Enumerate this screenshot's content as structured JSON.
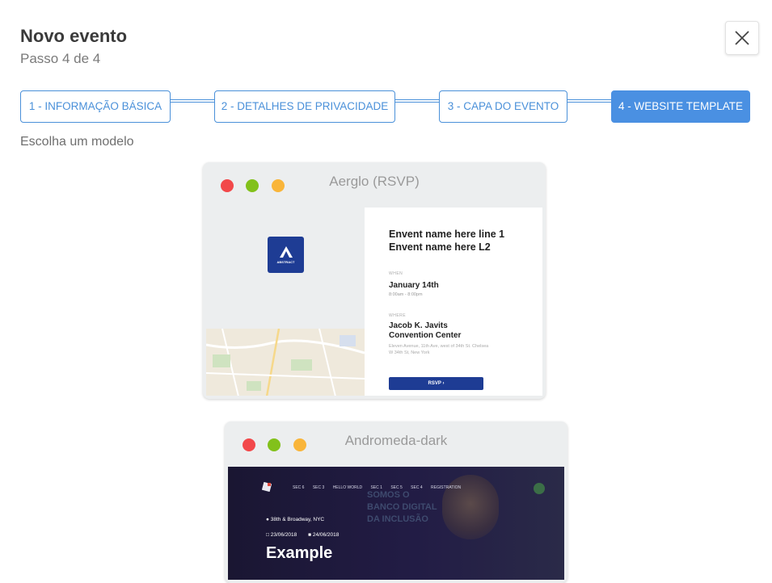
{
  "header": {
    "title": "Novo evento",
    "subtitle": "Passo 4 de 4"
  },
  "stepper": {
    "steps": [
      {
        "label": "1 - Informação básica",
        "active": false
      },
      {
        "label": "2 - Detalhes de privacidade",
        "active": false
      },
      {
        "label": "3 - Capa do evento",
        "active": false
      },
      {
        "label": "4 - Website template",
        "active": true
      }
    ]
  },
  "hint": "Escolha um modelo",
  "colors": {
    "accent": "#4a90e2",
    "dot_red": "#f2484a",
    "dot_green": "#82c11b",
    "dot_yellow": "#f9b53a",
    "aerglo_brand": "#1e3c94"
  },
  "templates": [
    {
      "name": "Aerglo (RSVP)",
      "preview": {
        "logo_text": "ABSTRACT",
        "event_name_line1": "Envent name here line 1",
        "event_name_line2": "Envent name here L2",
        "when_label": "WHEN",
        "date": "January 14th",
        "time": "8:00am - 8:00pm",
        "where_label": "WHERE",
        "venue_line1": "Jacob K. Javits",
        "venue_line2": "Convention Center",
        "address_line1": "Eleven Avenue, 11th Ave, west of 34th St. Chelsea",
        "address_line2": "W 34th St, New York",
        "button": "RSVP ›"
      }
    },
    {
      "name": "Andromeda-dark",
      "preview": {
        "nav": [
          "SEC 6",
          "SEC 3",
          "HELLO WORLD",
          "SEC 1",
          "SEC 5",
          "SEC 4",
          "REGISTRATION"
        ],
        "headline_line1": "SOMOS O",
        "headline_line2": "BANCO DIGITAL",
        "headline_line3": "DA INCLUSÃO",
        "location": "38th & Broadway, NYC",
        "start_date": "23/06/2018",
        "end_date": "24/06/2018",
        "example": "Example"
      }
    }
  ]
}
